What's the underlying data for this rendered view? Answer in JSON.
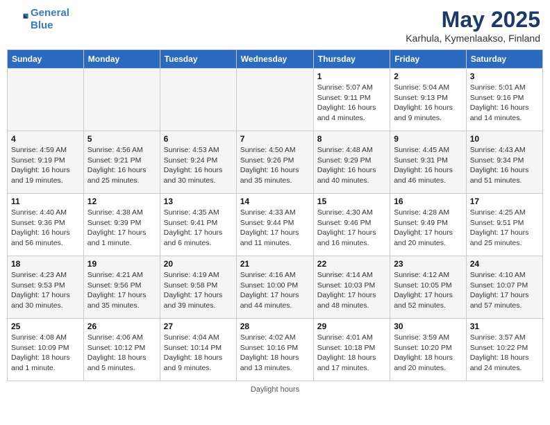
{
  "logo": {
    "line1": "General",
    "line2": "Blue"
  },
  "title": "May 2025",
  "subtitle": "Karhula, Kymenlaakso, Finland",
  "days": [
    "Sunday",
    "Monday",
    "Tuesday",
    "Wednesday",
    "Thursday",
    "Friday",
    "Saturday"
  ],
  "footer": "Daylight hours",
  "weeks": [
    [
      {
        "num": "",
        "text": "",
        "empty": true
      },
      {
        "num": "",
        "text": "",
        "empty": true
      },
      {
        "num": "",
        "text": "",
        "empty": true
      },
      {
        "num": "",
        "text": "",
        "empty": true
      },
      {
        "num": "1",
        "text": "Sunrise: 5:07 AM\nSunset: 9:11 PM\nDaylight: 16 hours\nand 4 minutes.",
        "empty": false
      },
      {
        "num": "2",
        "text": "Sunrise: 5:04 AM\nSunset: 9:13 PM\nDaylight: 16 hours\nand 9 minutes.",
        "empty": false
      },
      {
        "num": "3",
        "text": "Sunrise: 5:01 AM\nSunset: 9:16 PM\nDaylight: 16 hours\nand 14 minutes.",
        "empty": false
      }
    ],
    [
      {
        "num": "4",
        "text": "Sunrise: 4:59 AM\nSunset: 9:19 PM\nDaylight: 16 hours\nand 19 minutes.",
        "empty": false
      },
      {
        "num": "5",
        "text": "Sunrise: 4:56 AM\nSunset: 9:21 PM\nDaylight: 16 hours\nand 25 minutes.",
        "empty": false
      },
      {
        "num": "6",
        "text": "Sunrise: 4:53 AM\nSunset: 9:24 PM\nDaylight: 16 hours\nand 30 minutes.",
        "empty": false
      },
      {
        "num": "7",
        "text": "Sunrise: 4:50 AM\nSunset: 9:26 PM\nDaylight: 16 hours\nand 35 minutes.",
        "empty": false
      },
      {
        "num": "8",
        "text": "Sunrise: 4:48 AM\nSunset: 9:29 PM\nDaylight: 16 hours\nand 40 minutes.",
        "empty": false
      },
      {
        "num": "9",
        "text": "Sunrise: 4:45 AM\nSunset: 9:31 PM\nDaylight: 16 hours\nand 46 minutes.",
        "empty": false
      },
      {
        "num": "10",
        "text": "Sunrise: 4:43 AM\nSunset: 9:34 PM\nDaylight: 16 hours\nand 51 minutes.",
        "empty": false
      }
    ],
    [
      {
        "num": "11",
        "text": "Sunrise: 4:40 AM\nSunset: 9:36 PM\nDaylight: 16 hours\nand 56 minutes.",
        "empty": false
      },
      {
        "num": "12",
        "text": "Sunrise: 4:38 AM\nSunset: 9:39 PM\nDaylight: 17 hours\nand 1 minute.",
        "empty": false
      },
      {
        "num": "13",
        "text": "Sunrise: 4:35 AM\nSunset: 9:41 PM\nDaylight: 17 hours\nand 6 minutes.",
        "empty": false
      },
      {
        "num": "14",
        "text": "Sunrise: 4:33 AM\nSunset: 9:44 PM\nDaylight: 17 hours\nand 11 minutes.",
        "empty": false
      },
      {
        "num": "15",
        "text": "Sunrise: 4:30 AM\nSunset: 9:46 PM\nDaylight: 17 hours\nand 16 minutes.",
        "empty": false
      },
      {
        "num": "16",
        "text": "Sunrise: 4:28 AM\nSunset: 9:49 PM\nDaylight: 17 hours\nand 20 minutes.",
        "empty": false
      },
      {
        "num": "17",
        "text": "Sunrise: 4:25 AM\nSunset: 9:51 PM\nDaylight: 17 hours\nand 25 minutes.",
        "empty": false
      }
    ],
    [
      {
        "num": "18",
        "text": "Sunrise: 4:23 AM\nSunset: 9:53 PM\nDaylight: 17 hours\nand 30 minutes.",
        "empty": false
      },
      {
        "num": "19",
        "text": "Sunrise: 4:21 AM\nSunset: 9:56 PM\nDaylight: 17 hours\nand 35 minutes.",
        "empty": false
      },
      {
        "num": "20",
        "text": "Sunrise: 4:19 AM\nSunset: 9:58 PM\nDaylight: 17 hours\nand 39 minutes.",
        "empty": false
      },
      {
        "num": "21",
        "text": "Sunrise: 4:16 AM\nSunset: 10:00 PM\nDaylight: 17 hours\nand 44 minutes.",
        "empty": false
      },
      {
        "num": "22",
        "text": "Sunrise: 4:14 AM\nSunset: 10:03 PM\nDaylight: 17 hours\nand 48 minutes.",
        "empty": false
      },
      {
        "num": "23",
        "text": "Sunrise: 4:12 AM\nSunset: 10:05 PM\nDaylight: 17 hours\nand 52 minutes.",
        "empty": false
      },
      {
        "num": "24",
        "text": "Sunrise: 4:10 AM\nSunset: 10:07 PM\nDaylight: 17 hours\nand 57 minutes.",
        "empty": false
      }
    ],
    [
      {
        "num": "25",
        "text": "Sunrise: 4:08 AM\nSunset: 10:09 PM\nDaylight: 18 hours\nand 1 minute.",
        "empty": false
      },
      {
        "num": "26",
        "text": "Sunrise: 4:06 AM\nSunset: 10:12 PM\nDaylight: 18 hours\nand 5 minutes.",
        "empty": false
      },
      {
        "num": "27",
        "text": "Sunrise: 4:04 AM\nSunset: 10:14 PM\nDaylight: 18 hours\nand 9 minutes.",
        "empty": false
      },
      {
        "num": "28",
        "text": "Sunrise: 4:02 AM\nSunset: 10:16 PM\nDaylight: 18 hours\nand 13 minutes.",
        "empty": false
      },
      {
        "num": "29",
        "text": "Sunrise: 4:01 AM\nSunset: 10:18 PM\nDaylight: 18 hours\nand 17 minutes.",
        "empty": false
      },
      {
        "num": "30",
        "text": "Sunrise: 3:59 AM\nSunset: 10:20 PM\nDaylight: 18 hours\nand 20 minutes.",
        "empty": false
      },
      {
        "num": "31",
        "text": "Sunrise: 3:57 AM\nSunset: 10:22 PM\nDaylight: 18 hours\nand 24 minutes.",
        "empty": false
      }
    ]
  ]
}
